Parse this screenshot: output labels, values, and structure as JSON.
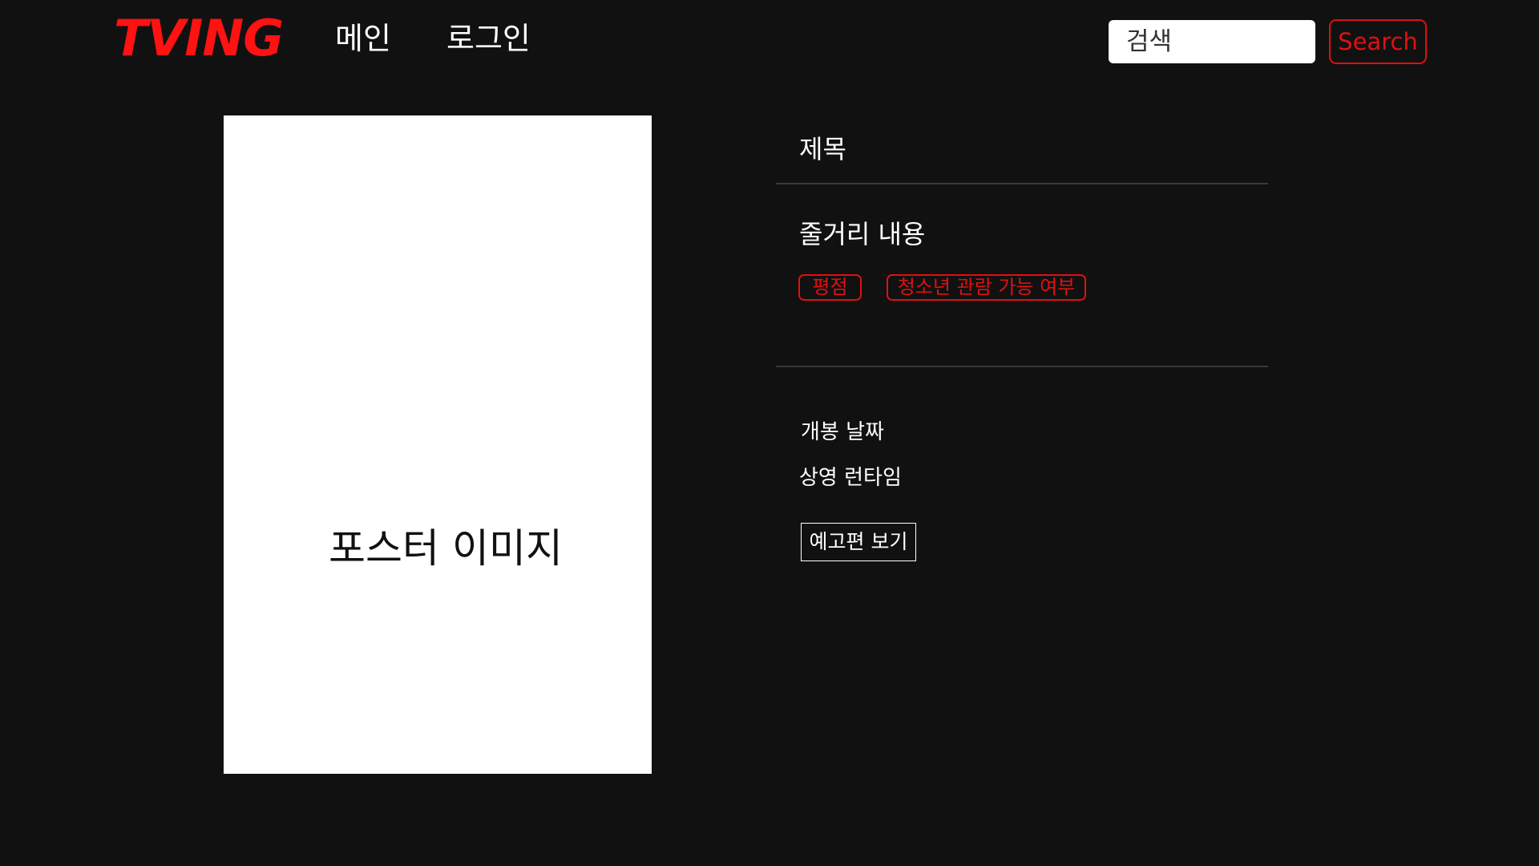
{
  "header": {
    "logo": "TVING",
    "nav": [
      {
        "label": "메인"
      },
      {
        "label": "로그인"
      }
    ],
    "search": {
      "placeholder": "검색",
      "value": "",
      "button_label": "Search"
    }
  },
  "poster": {
    "label": "포스터 이미지"
  },
  "info": {
    "title": "제목",
    "synopsis": "줄거리 내용",
    "badges": {
      "rating": "평점",
      "age": "청소년 관람 가능 여부"
    },
    "release_date": "개봉 날짜",
    "runtime": "상영 런타임",
    "trailer_button": "예고편 보기"
  },
  "colors": {
    "background": "#111111",
    "accent": "#e01010",
    "logo": "#ff1212",
    "text": "#ffffff",
    "divider": "#3a3a3a"
  }
}
